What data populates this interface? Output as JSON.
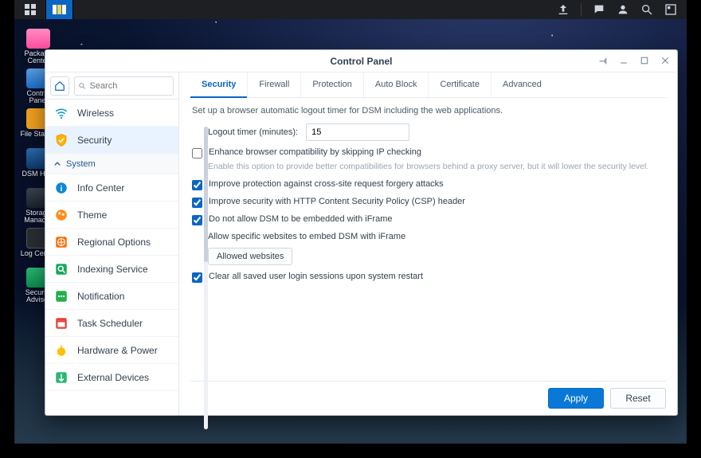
{
  "taskbar": {},
  "desktop_icons": [
    {
      "label": "Package Center",
      "cls": "b1"
    },
    {
      "label": "Control Panel",
      "cls": "b2"
    },
    {
      "label": "File Station",
      "cls": "b3"
    },
    {
      "label": "DSM Help",
      "cls": "b4"
    },
    {
      "label": "Storage Manager",
      "cls": "b5"
    },
    {
      "label": "Log Center",
      "cls": "b6"
    },
    {
      "label": "Security Advisor",
      "cls": "b7"
    }
  ],
  "window": {
    "title": "Control Panel",
    "search_placeholder": "Search",
    "sidebar": {
      "top_item": "Wireless",
      "active_item": "Security",
      "group": "System",
      "items": [
        "Info Center",
        "Theme",
        "Regional Options",
        "Indexing Service",
        "Notification",
        "Task Scheduler",
        "Hardware & Power",
        "External Devices"
      ]
    },
    "tabs": [
      "Security",
      "Firewall",
      "Protection",
      "Auto Block",
      "Certificate",
      "Advanced"
    ],
    "active_tab": "Security",
    "content": {
      "description": "Set up a browser automatic logout timer for DSM including the web applications.",
      "logout_label": "Logout timer (minutes):",
      "logout_value": "15",
      "chk_compat": "Enhance browser compatibility by skipping IP checking",
      "compat_hint": "Enable this option to provide better compatibilities for browsers behind a proxy server, but it will lower the security level.",
      "chk_csrf": "Improve protection against cross-site request forgery attacks",
      "chk_csp": "Improve security with HTTP Content Security Policy (CSP) header",
      "chk_iframe": "Do not allow DSM to be embedded with iFrame",
      "iframe_sub": "Allow specific websites to embed DSM with iFrame",
      "allowed_btn": "Allowed websites",
      "chk_clear": "Clear all saved user login sessions upon system restart"
    },
    "buttons": {
      "apply": "Apply",
      "reset": "Reset"
    }
  }
}
